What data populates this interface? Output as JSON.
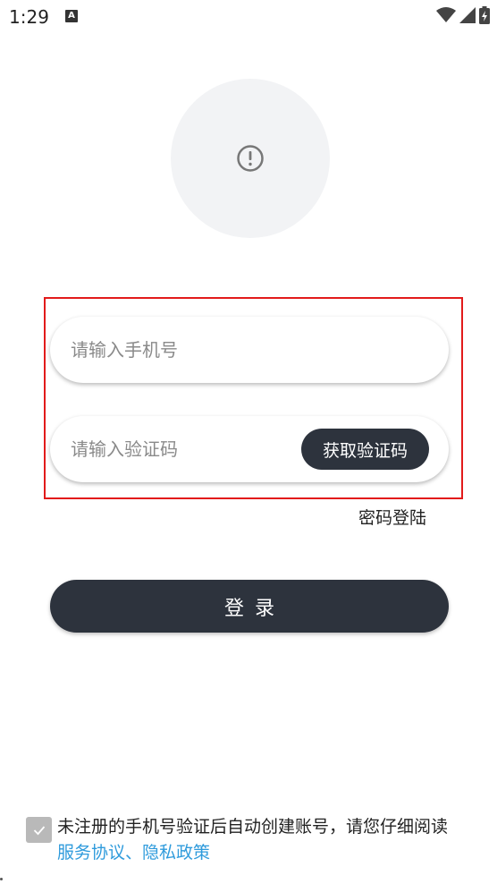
{
  "status_bar": {
    "time": "1:29",
    "notification_icon": "A"
  },
  "avatar": {
    "icon": "alert-circle-icon"
  },
  "form": {
    "phone_placeholder": "请输入手机号",
    "code_placeholder": "请输入验证码",
    "get_code_label": "获取验证码",
    "password_login_label": "密码登陆"
  },
  "login_label": "登录",
  "agreement": {
    "checked": true,
    "text": "未注册的手机号验证后自动创建账号，请您仔细阅读",
    "links": "服务协议、隐私政策"
  },
  "colors": {
    "primary_dark": "#2d333d",
    "link": "#2f9bdc",
    "highlight_border": "#e21b1b",
    "avatar_bg": "#f2f3f5"
  }
}
